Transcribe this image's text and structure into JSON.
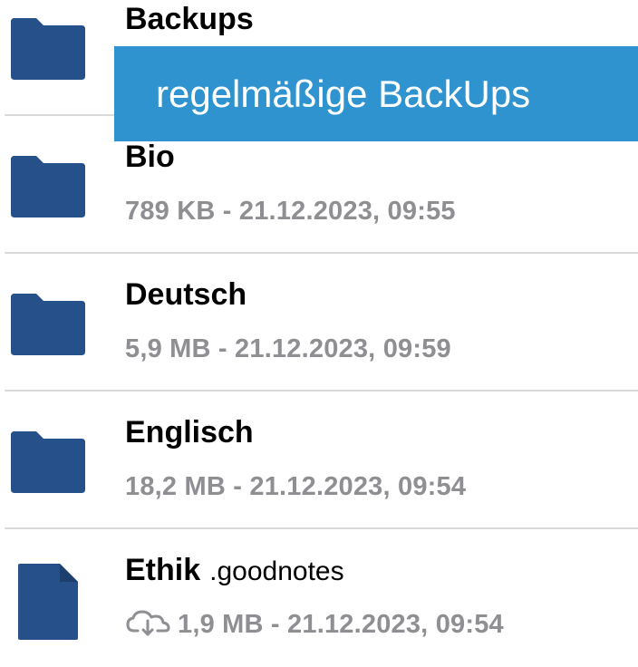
{
  "files": [
    {
      "name": "Backups",
      "extension": "",
      "kind": "folder",
      "meta": "",
      "cloud": false
    },
    {
      "name": "Bio",
      "extension": "",
      "kind": "folder",
      "meta": "789 KB - 21.12.2023, 09:55",
      "cloud": false
    },
    {
      "name": "Deutsch",
      "extension": "",
      "kind": "folder",
      "meta": "5,9 MB - 21.12.2023, 09:59",
      "cloud": false
    },
    {
      "name": "Englisch",
      "extension": "",
      "kind": "folder",
      "meta": "18,2 MB - 21.12.2023, 09:54",
      "cloud": false
    },
    {
      "name": "Ethik",
      "extension": ".goodnotes",
      "kind": "document",
      "meta": "1,9 MB - 21.12.2023, 09:54",
      "cloud": true
    }
  ],
  "caption": "regelmäßige BackUps",
  "colors": {
    "icon": "#26508a",
    "caption_bg": "#2e93cf",
    "meta_text": "#8e8e93",
    "divider": "#d9d9d9"
  },
  "icons": {
    "folder": "folder-icon",
    "document": "document-icon",
    "cloud": "cloud-download-icon"
  }
}
